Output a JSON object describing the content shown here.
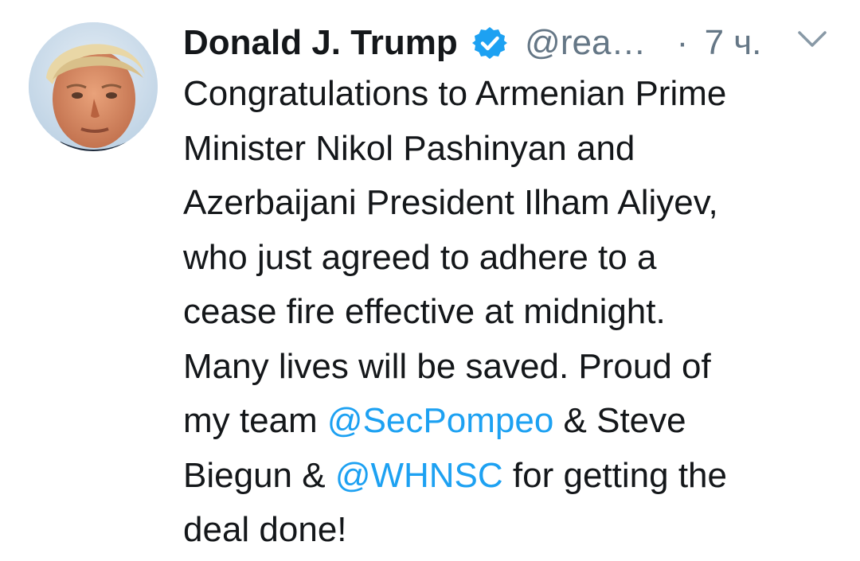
{
  "author": {
    "name": "Donald J. Trump",
    "handle": "@rea…",
    "separator": "·",
    "time": "7 ч."
  },
  "icons": {
    "verified": "verified-badge-icon",
    "menu": "chevron-down-icon",
    "avatar": "profile-avatar"
  },
  "colors": {
    "text": "#14171a",
    "muted": "#657786",
    "link": "#1da1f2"
  },
  "tweet": {
    "l1": "Congratulations to Armenian Prime",
    "l2": "Minister Nikol Pashinyan and",
    "l3": "Azerbaijani President Ilham Aliyev,",
    "l4": "who just agreed to adhere to a",
    "l5": "cease fire effective at midnight.",
    "l6": "Many lives will be saved. Proud of",
    "l7a": "my team ",
    "mention1": "@SecPompeo",
    "l7b": " & Steve",
    "l8a": "Biegun & ",
    "mention2": "@WHNSC",
    "l8b": " for getting the",
    "l9": "deal done!"
  }
}
